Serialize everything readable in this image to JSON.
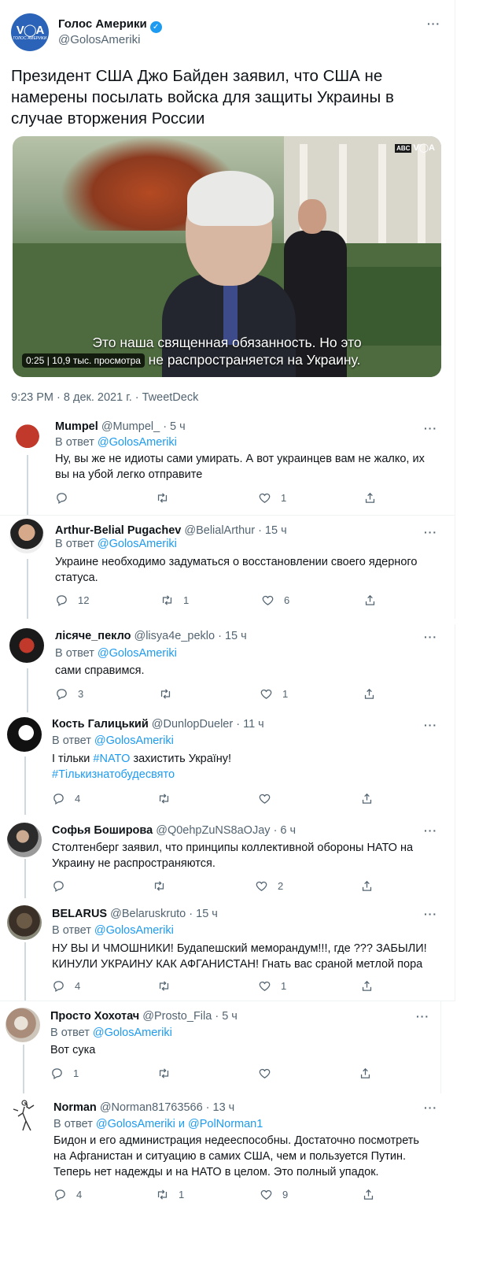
{
  "main_tweet": {
    "author_name": "Голос Америки",
    "handle": "@GolosAmeriki",
    "avatar_text": "V◯A",
    "avatar_small": "ГОЛОС АМЕРИКИ",
    "text": "Президент США Джо Байден заявил, что США не намерены посылать войска для защиты Украины в случае вторжения России",
    "video": {
      "logo_a": "ABC",
      "logo_b": "V◯A",
      "subtitle_line1": "Это наша священная обязанность. Но это",
      "subtitle_line2": "не распространяется на Украину.",
      "time_views": "0:25 | 10,9 тыс. просмотра"
    },
    "meta": "9:23 PM · 8 дек. 2021 г. · TweetDeck"
  },
  "in_reply_label": "В ответ",
  "replies": [
    {
      "name": "Mumpel",
      "handle": "@Mumpel_",
      "time": "· 5 ч",
      "reply_to": "@GolosAmeriki",
      "text": "Ну, вы же не идиоты сами умирать. А вот украинцев вам не жалко, их вы на убой легко отправите",
      "replies_count": "",
      "retweets_count": "",
      "likes_count": "1"
    },
    {
      "name": "Arthur-Belial Pugachev",
      "handle": "@BelialArthur",
      "time": "· 15 ч",
      "reply_to": "@GolosAmeriki",
      "text": "Украине необходимо задуматься о восстановлении своего ядерного статуса.",
      "replies_count": "12",
      "retweets_count": "1",
      "likes_count": "6"
    },
    {
      "name": "лісяче_пекло",
      "handle": "@lisya4e_peklo",
      "time": "· 15 ч",
      "reply_to": "@GolosAmeriki",
      "text": "сами справимся.",
      "replies_count": "3",
      "retweets_count": "",
      "likes_count": "1"
    },
    {
      "name": "Кость Галицький",
      "handle": "@DunlopDueler",
      "time": "· 11 ч",
      "reply_to": "@GolosAmeriki",
      "text_parts": [
        "І тільки ",
        "#NATO",
        " захистить Україну!"
      ],
      "hashtag_line": "#Тількизнатобудесвято",
      "replies_count": "4",
      "retweets_count": "",
      "likes_count": ""
    },
    {
      "name": "Софья Боширова",
      "handle": "@Q0ehpZuNS8aOJay",
      "time": "· 6 ч",
      "text": "Столтенберг заявил, что принципы коллективной обороны НАТО на Украину не распространяются.",
      "replies_count": "",
      "retweets_count": "",
      "likes_count": "2"
    },
    {
      "name": "BELARUS",
      "handle": "@Belaruskruto",
      "time": "· 15 ч",
      "reply_to": "@GolosAmeriki",
      "text": "НУ ВЫ И ЧМОШНИКИ! Будапешский меморандум!!!, где ???  ЗАБЫЛИ! КИНУЛИ УКРАИНУ КАК АФГАНИСТАН! Гнать вас сраной метлой пора",
      "replies_count": "4",
      "retweets_count": "",
      "likes_count": "1"
    },
    {
      "name": "Просто Хохотач",
      "handle": "@Prosto_Fila",
      "time": "· 5 ч",
      "reply_to": "@GolosAmeriki",
      "text": "Вот сука",
      "replies_count": "1",
      "retweets_count": "",
      "likes_count": ""
    },
    {
      "name": "Norman",
      "handle": "@Norman81763566",
      "time": "· 13 ч",
      "reply_to": "@GolosAmeriki",
      "reply_and": "и",
      "reply_to2": "@PolNorman1",
      "text": "Бидон и его администрация недееспособны. Достаточно посмотреть на Афганистан и ситуацию в самих США, чем и пользуется Путин. Теперь нет надежды и на НАТО в целом. Это полный упадок.",
      "replies_count": "4",
      "retweets_count": "1",
      "likes_count": "9"
    }
  ],
  "more_label": "···",
  "colors": {
    "link": "#1d9bf0",
    "secondary": "#536471",
    "text": "#0f1419",
    "verified": "#1d9bf0"
  }
}
